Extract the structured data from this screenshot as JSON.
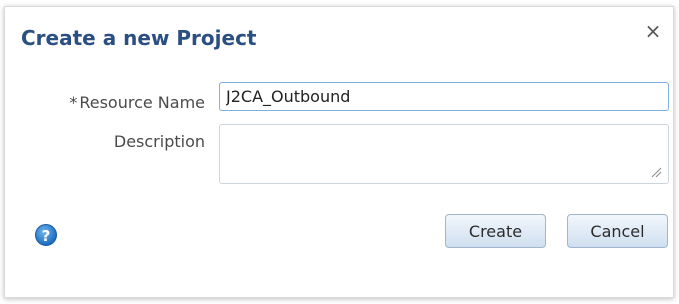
{
  "dialog": {
    "title": "Create a new Project",
    "close_glyph": "×"
  },
  "form": {
    "resource_name": {
      "required_marker": "*",
      "label": "Resource Name",
      "value": "J2CA_Outbound"
    },
    "description": {
      "label": "Description",
      "value": ""
    }
  },
  "actions": {
    "help_glyph": "?",
    "create_label": "Create",
    "cancel_label": "Cancel"
  },
  "icons": {
    "close": "close-icon",
    "help": "help-icon",
    "resize": "resize-grip-icon"
  },
  "colors": {
    "title": "#2b4f81",
    "focus_border": "#7fb1e0",
    "help_blue": "#1e6fc2"
  }
}
